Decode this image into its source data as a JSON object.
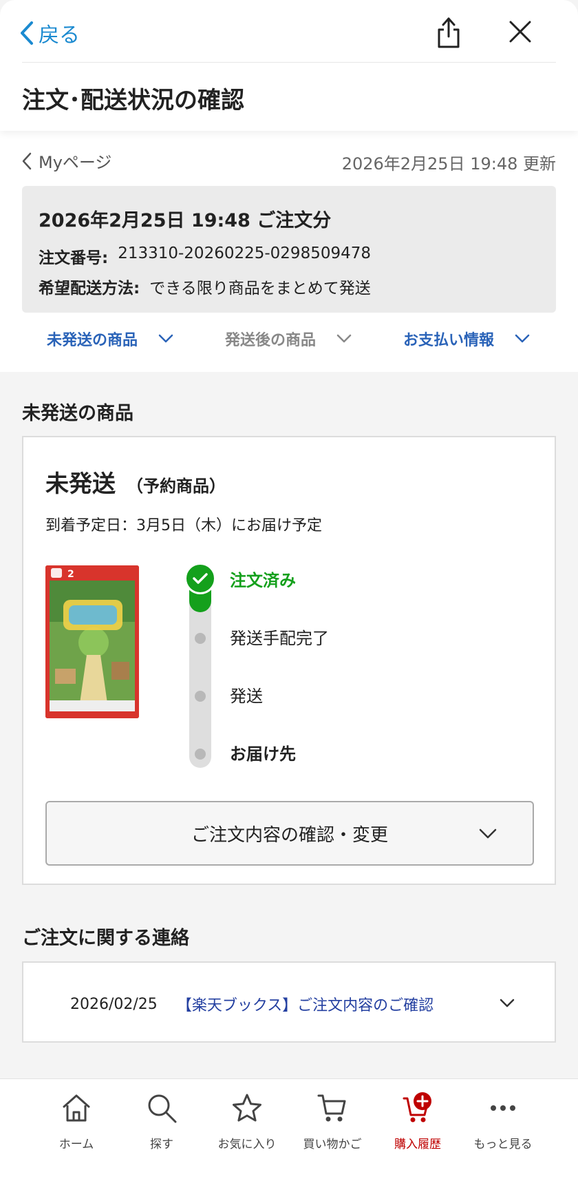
{
  "topbar": {
    "back_label": "戻る",
    "page_title": "注文･配送状況の確認"
  },
  "subheader": {
    "mypage_label": "Myページ",
    "updated_text": "2026年2月25日 19:48 更新"
  },
  "order": {
    "date_title": "2026年2月25日 19:48 ご注文分",
    "number_key": "注文番号:",
    "number_value": "213310-20260225-0298509478",
    "method_key": "希望配送方法:",
    "method_value": "できる限り商品をまとめて発送"
  },
  "tabs": [
    {
      "label": "未発送の商品",
      "color": "#2a63b8"
    },
    {
      "label": "発送後の商品",
      "color": "#888888"
    },
    {
      "label": "お支払い情報",
      "color": "#2a63b8"
    }
  ],
  "unshipped": {
    "section_title": "未発送の商品",
    "status_main": "未発送",
    "status_sub": "（予約商品）",
    "arrival_text": "到着予定日：3月5日（木）にお届け予定",
    "product_image_badge": "2",
    "steps": [
      {
        "label": "注文済み",
        "done": true
      },
      {
        "label": "発送手配完了",
        "done": false
      },
      {
        "label": "発送",
        "done": false
      },
      {
        "label": "お届け先",
        "done": false
      }
    ],
    "confirm_button": "ご注文内容の確認・変更"
  },
  "messages": {
    "section_title": "ご注文に関する連絡",
    "items": [
      {
        "date": "2026/02/25",
        "title": "【楽天ブックス】ご注文内容のご確認"
      }
    ]
  },
  "bottom_nav": [
    {
      "label": "ホーム",
      "icon": "home-icon"
    },
    {
      "label": "探す",
      "icon": "search-icon"
    },
    {
      "label": "お気に入り",
      "icon": "star-icon"
    },
    {
      "label": "買い物かご",
      "icon": "cart-icon"
    },
    {
      "label": "購入履歴",
      "icon": "purchase-history-icon",
      "active": true
    },
    {
      "label": "もっと見る",
      "icon": "more-icon"
    }
  ],
  "colors": {
    "link_blue": "#1b8ad0",
    "tab_blue": "#2a63b8",
    "done_green": "#14a01c",
    "active_red": "#bf0000"
  }
}
